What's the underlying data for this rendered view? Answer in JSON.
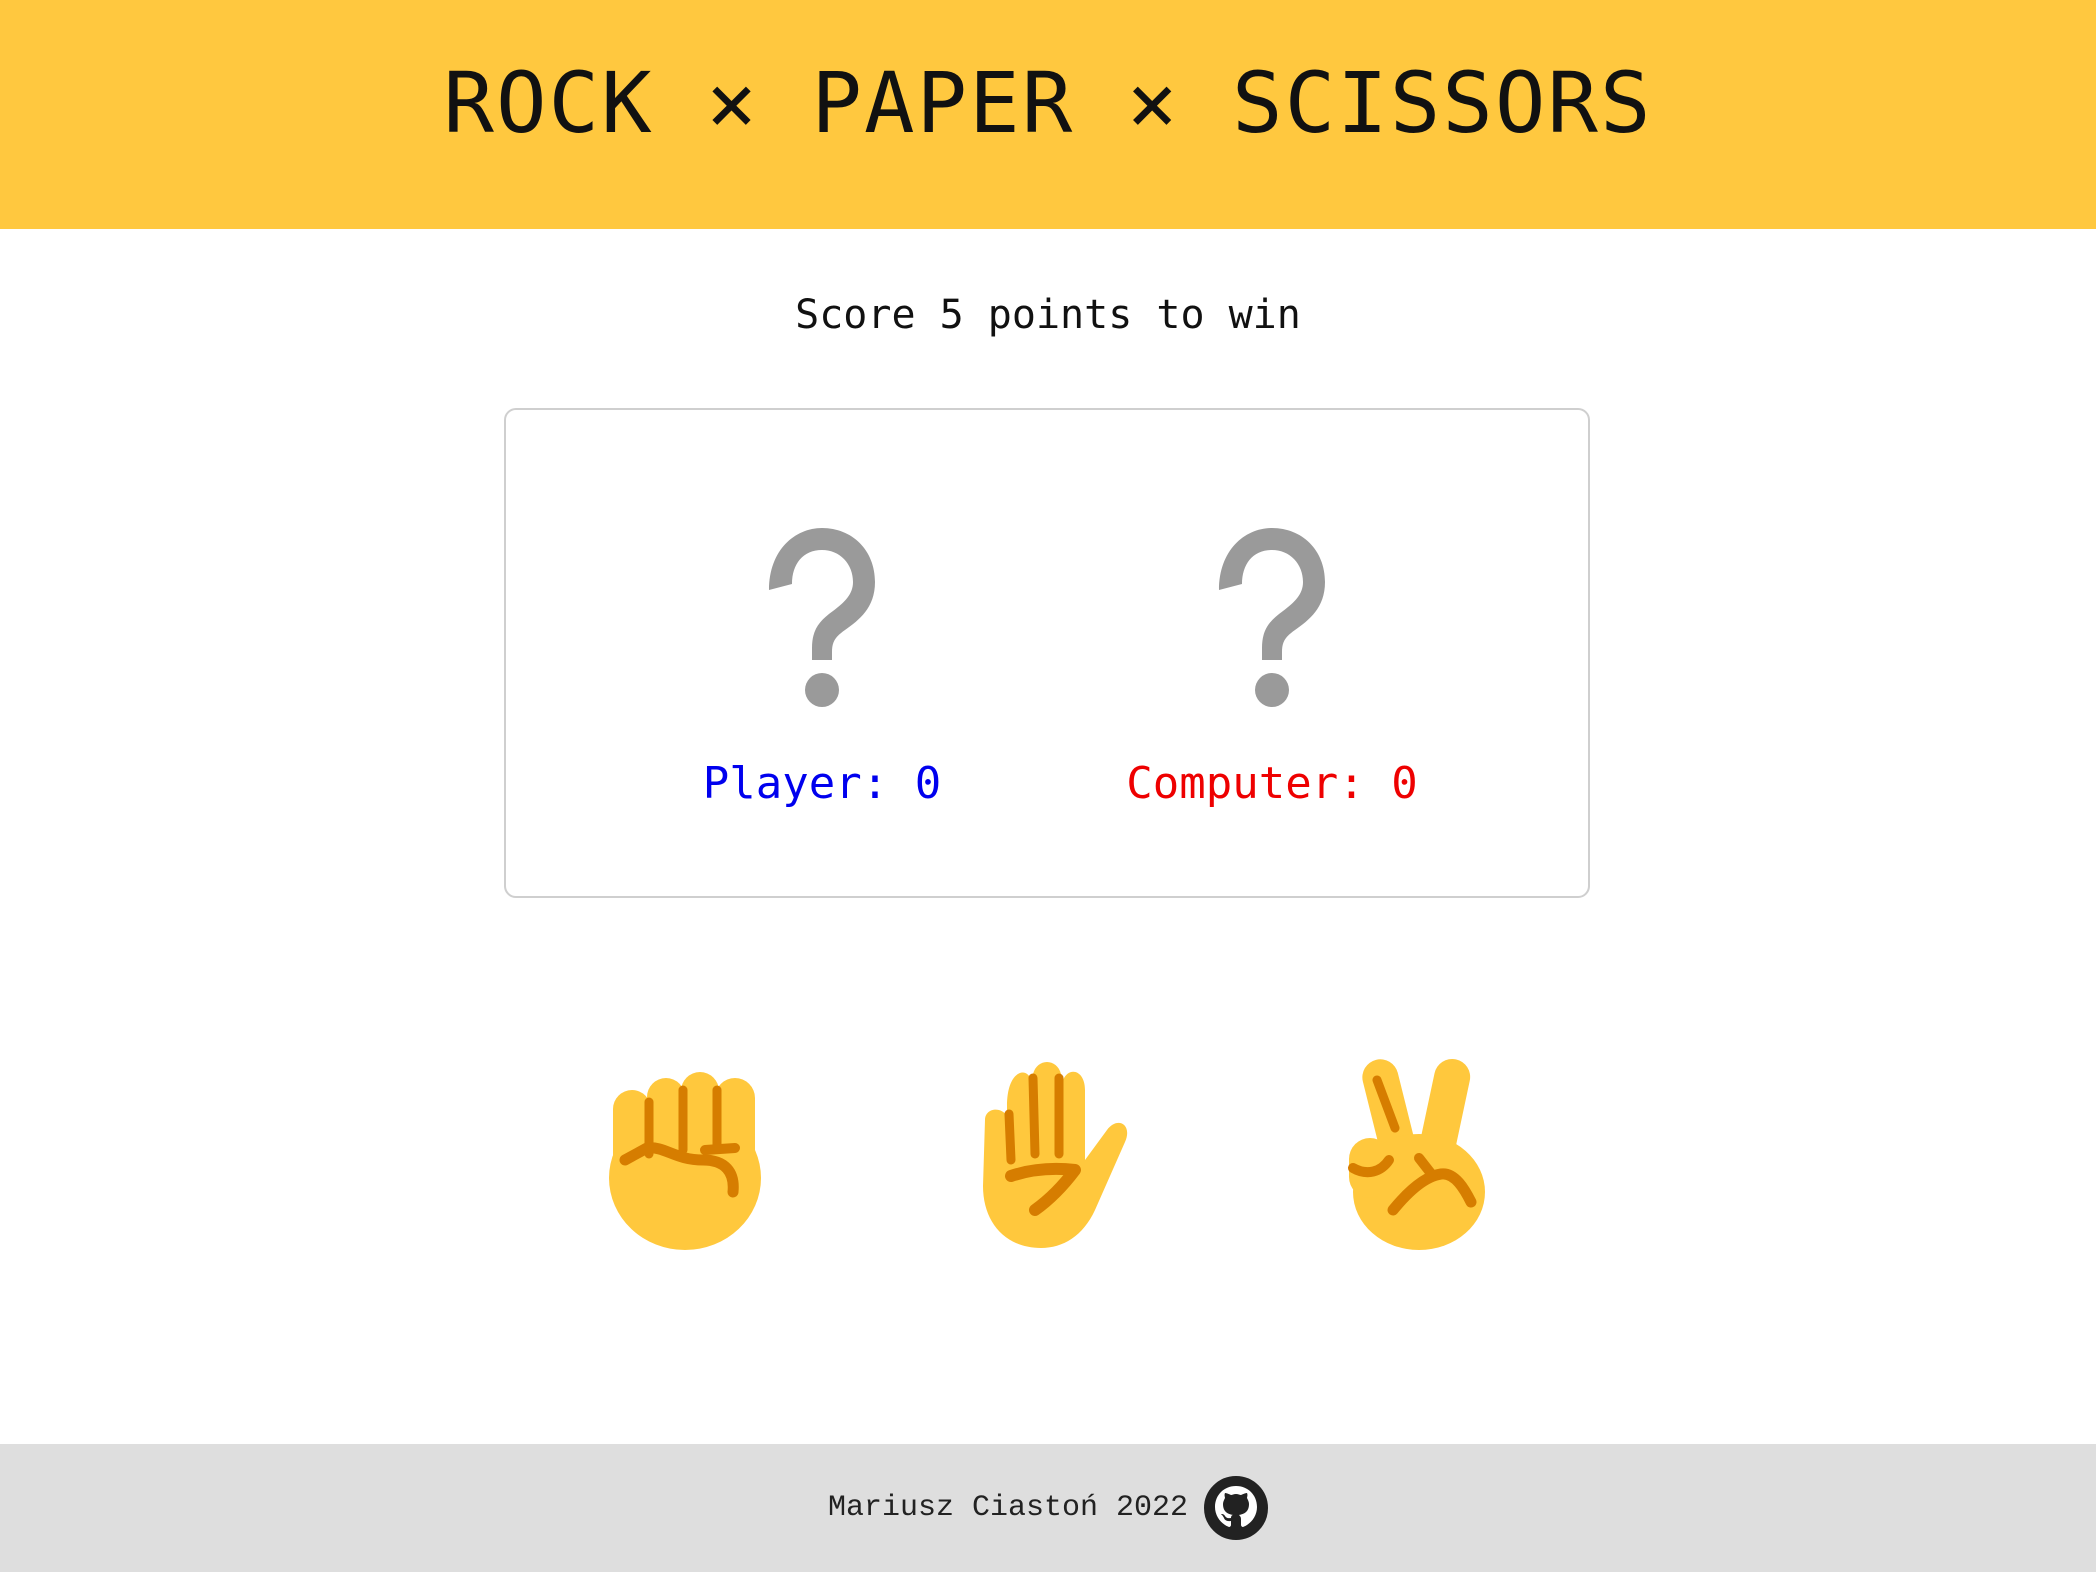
{
  "header": {
    "title": "ROCK × PAPER × SCISSORS"
  },
  "subtitle": "Score 5 points to win",
  "scoreboard": {
    "player": {
      "label": "Player: 0",
      "choice_icon": "question-mark-icon"
    },
    "computer": {
      "label": "Computer: 0",
      "choice_icon": "question-mark-icon"
    }
  },
  "choices": [
    {
      "id": "rock",
      "icon": "raised-fist-icon"
    },
    {
      "id": "paper",
      "icon": "raised-hand-icon"
    },
    {
      "id": "scissors",
      "icon": "victory-hand-icon"
    }
  ],
  "footer": {
    "text": "Mariusz Ciastoń 2022",
    "icon": "github-icon"
  },
  "colors": {
    "header_bg": "#ffc83f",
    "player": "#0000ee",
    "computer": "#ee0000",
    "question_mark": "#9a9a9a",
    "hand_skin": "#ffc83d",
    "hand_shadow": "#d67d00",
    "footer_bg": "#dedede"
  }
}
